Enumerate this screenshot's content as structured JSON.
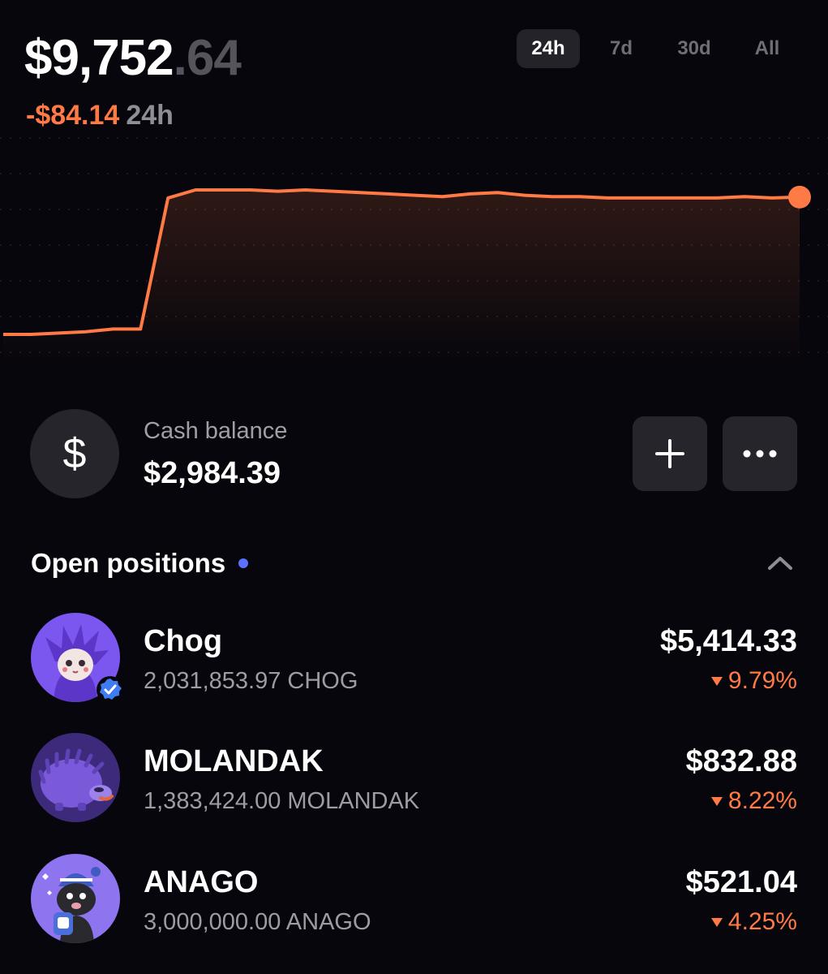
{
  "header": {
    "balance_int": "$9,752",
    "balance_dec": ".64",
    "change_value": "-$84.14",
    "change_period": "24h"
  },
  "range_tabs": [
    {
      "label": "24h",
      "active": true
    },
    {
      "label": "7d",
      "active": false
    },
    {
      "label": "30d",
      "active": false
    },
    {
      "label": "All",
      "active": false
    }
  ],
  "chart_data": {
    "type": "line",
    "title": "",
    "xlabel": "",
    "ylabel": "",
    "grid": true,
    "line_color": "#ff7a45",
    "values": [
      9650,
      9650,
      9651,
      9652,
      9654,
      9654,
      9752,
      9758,
      9758,
      9758,
      9757,
      9758,
      9757,
      9756,
      9755,
      9754,
      9753,
      9755,
      9756,
      9754,
      9753,
      9753,
      9752,
      9752,
      9752,
      9752,
      9752,
      9753,
      9752,
      9752.64
    ]
  },
  "cash": {
    "icon": "dollar-icon",
    "label": "Cash balance",
    "value": "$2,984.39",
    "add_icon": "plus-icon",
    "more_icon": "more-icon"
  },
  "positions": {
    "title": "Open positions",
    "collapse_icon": "chevron-up-icon",
    "items": [
      {
        "name": "Chog",
        "amount": "2,031,853.97 CHOG",
        "value": "$5,414.33",
        "change": "9.79%",
        "verified": true
      },
      {
        "name": "MOLANDAK",
        "amount": "1,383,424.00 MOLANDAK",
        "value": "$832.88",
        "change": "8.22%",
        "verified": false
      },
      {
        "name": "ANAGO",
        "amount": "3,000,000.00 ANAGO",
        "value": "$521.04",
        "change": "4.25%",
        "verified": false
      }
    ]
  },
  "colors": {
    "accent": "#ff7a45",
    "background": "#07060c",
    "surface": "#26252c",
    "dot": "#5a72ff"
  }
}
